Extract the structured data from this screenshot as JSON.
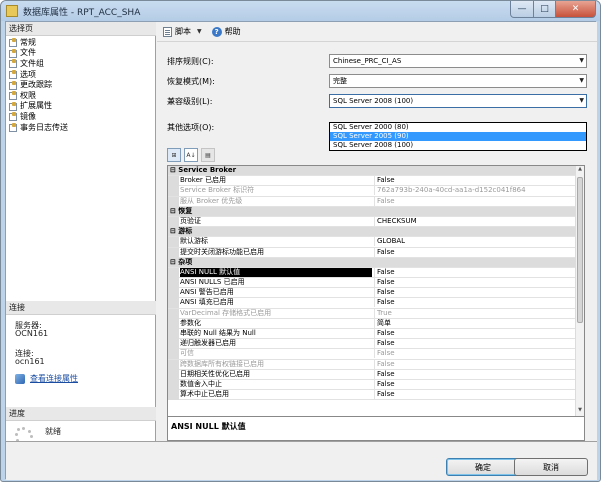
{
  "window": {
    "title": "数据库属性 - RPT_ACC_SHA",
    "close_glyph": "✕",
    "min_glyph": "—",
    "max_glyph": "□"
  },
  "left": {
    "select_page_header": "选择页",
    "pages": [
      "常规",
      "文件",
      "文件组",
      "选项",
      "更改跟踪",
      "权限",
      "扩展属性",
      "镜像",
      "事务日志传送"
    ],
    "connection_header": "连接",
    "server_label": "服务器:",
    "server_value": "OCN161",
    "connection_label": "连接:",
    "connection_value": "ocn161",
    "view_link": "查看连接属性",
    "progress_header": "进度",
    "progress_status": "就绪"
  },
  "toolbar": {
    "script_label": "脚本",
    "help_label": "帮助",
    "help_glyph": "?",
    "dropdown_glyph": "▼"
  },
  "form": {
    "collation_label": "排序规则(C):",
    "collation_value": "Chinese_PRC_CI_AS",
    "recovery_label": "恢复模式(M):",
    "recovery_value": "完整",
    "compat_label": "兼容级别(L):",
    "compat_value": "SQL Server 2008 (100)",
    "compat_options": [
      "SQL Server 2000 (80)",
      "SQL Server 2005 (90)",
      "SQL Server 2008 (100)"
    ],
    "compat_highlighted": "SQL Server 2005 (90)",
    "other_label": "其他选项(O):",
    "combo_arrow": "▼"
  },
  "grid_tools": {
    "categorized_glyph": "⊞",
    "alpha_glyph": "A↓",
    "pages_glyph": "▤"
  },
  "grid": {
    "rows": [
      {
        "type": "cat",
        "name": "⊟ Service Broker",
        "value": ""
      },
      {
        "type": "prop",
        "name": "Broker 已启用",
        "value": "False"
      },
      {
        "type": "dim",
        "name": "Service Broker 标识符",
        "value": "762a793b-240a-40cd-aa1a-d152c041f864"
      },
      {
        "type": "dim",
        "name": "服从 Broker 优先级",
        "value": "False"
      },
      {
        "type": "cat",
        "name": "⊟ 恢复",
        "value": ""
      },
      {
        "type": "prop",
        "name": "页验证",
        "value": "CHECKSUM"
      },
      {
        "type": "cat",
        "name": "⊟ 游标",
        "value": ""
      },
      {
        "type": "prop",
        "name": "默认游标",
        "value": "GLOBAL"
      },
      {
        "type": "prop",
        "name": "提交时关闭游标功能已启用",
        "value": "False"
      },
      {
        "type": "cat",
        "name": "⊟ 杂项",
        "value": ""
      },
      {
        "type": "sel",
        "name": "ANSI NULL 默认值",
        "value": "False"
      },
      {
        "type": "prop",
        "name": "ANSI NULLS 已启用",
        "value": "False"
      },
      {
        "type": "prop",
        "name": "ANSI 警告已启用",
        "value": "False"
      },
      {
        "type": "prop",
        "name": "ANSI 填充已启用",
        "value": "False"
      },
      {
        "type": "dim",
        "name": "VarDecimal 存储格式已启用",
        "value": "True"
      },
      {
        "type": "prop",
        "name": "参数化",
        "value": "简单"
      },
      {
        "type": "prop",
        "name": "串联的 Null 结果为 Null",
        "value": "False"
      },
      {
        "type": "prop",
        "name": "递归触发器已启用",
        "value": "False"
      },
      {
        "type": "dim",
        "name": "可信",
        "value": "False"
      },
      {
        "type": "dim",
        "name": "跨数据库所有权链接已启用",
        "value": "False"
      },
      {
        "type": "prop",
        "name": "日期相关性优化已启用",
        "value": "False"
      },
      {
        "type": "prop",
        "name": "数值舍入中止",
        "value": "False"
      },
      {
        "type": "prop",
        "name": "算术中止已启用",
        "value": "False"
      }
    ],
    "scroll_up": "▲",
    "scroll_down": "▼"
  },
  "description": "ANSI NULL 默认值",
  "buttons": {
    "ok": "确定",
    "cancel": "取消"
  }
}
